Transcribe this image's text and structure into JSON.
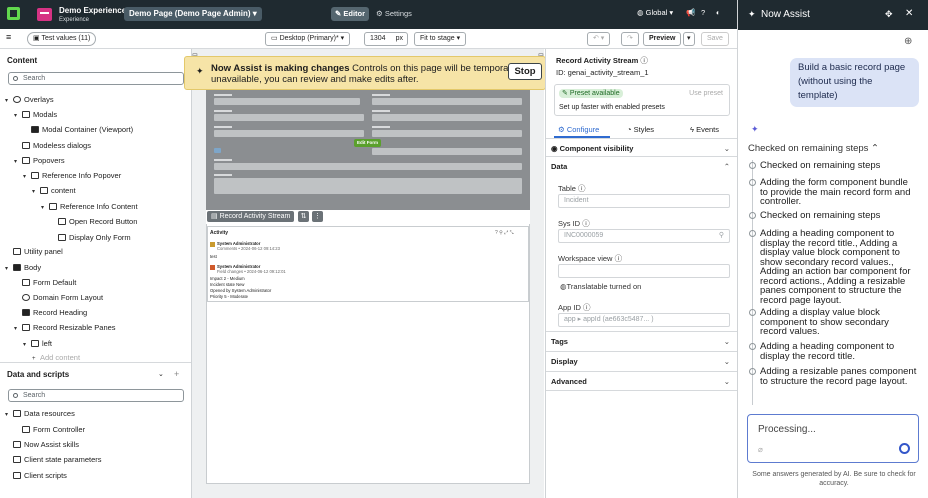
{
  "topbar": {
    "exp_title": "Demo Experience",
    "exp_sub": "Experience",
    "page_select": "Demo Page (Demo Page Admin)",
    "editor": "Editor",
    "settings": "Settings",
    "scope": "Global"
  },
  "toolbar": {
    "test_values": "Test values (11)",
    "device": "Desktop (Primary)*",
    "width": "1304",
    "width_unit": "px",
    "fit": "Fit to stage",
    "preview": "Preview",
    "save": "Save"
  },
  "left": {
    "content_title": "Content",
    "search_placeholder": "Search",
    "tree": [
      {
        "label": "Overlays"
      },
      {
        "label": "Modals"
      },
      {
        "label": "Modal Container (Viewport)"
      },
      {
        "label": "Modeless dialogs"
      },
      {
        "label": "Popovers"
      },
      {
        "label": "Reference Info Popover"
      },
      {
        "label": "content"
      },
      {
        "label": "Reference Info Content"
      },
      {
        "label": "Open Record Button"
      },
      {
        "label": "Display Only Form"
      },
      {
        "label": "Utility panel"
      },
      {
        "label": "Body"
      },
      {
        "label": "Form Default"
      },
      {
        "label": "Domain Form Layout"
      },
      {
        "label": "Record Heading"
      },
      {
        "label": "Record Resizable Panes"
      },
      {
        "label": "left"
      },
      {
        "label": "Add content"
      }
    ],
    "data_title": "Data and scripts",
    "data_search": "Search",
    "data_tree": [
      {
        "label": "Data resources"
      },
      {
        "label": "Form Controller"
      },
      {
        "label": "Now Assist skills"
      },
      {
        "label": "Client state parameters"
      },
      {
        "label": "Client scripts"
      }
    ]
  },
  "banner": {
    "bold": "Now Assist is making changes",
    "text": " Controls on this page will be temporarily unavailable, you can review and make edits after.",
    "stop": "Stop"
  },
  "stage": {
    "ras_tag": "Record Activity Stream",
    "edit_form": "Edit Form",
    "activity_title": "Activity",
    "act_lines": [
      "System Administrator",
      "Comments • 2024-06-12 09:14:23",
      "test",
      "System Administrator",
      "Field changes • 2024-06-12 09:12:01",
      "Impact          2 - Medium",
      "Incident state  New",
      "Opened by       System Administrator",
      "Priority        5 - Moderate"
    ]
  },
  "config": {
    "title": "Record Activity Stream",
    "id": "ID: genai_activity_stream_1",
    "preset_badge": "Preset available",
    "use_preset": "Use preset",
    "preset_desc": "Set up faster with enabled presets",
    "tabs": [
      "Configure",
      "Styles",
      "Events"
    ],
    "visibility": "Component visibility",
    "data_section": "Data",
    "table_label": "Table",
    "table_placeholder": "Incident",
    "sysid_label": "Sys ID",
    "sysid_placeholder": "INC0000059",
    "workspace_label": "Workspace view",
    "translatable": "Translatable turned on",
    "appid_label": "App ID",
    "appid_placeholder": "app ▸ appId (ae663c5487... )",
    "tags": "Tags",
    "display": "Display",
    "advanced": "Advanced"
  },
  "assist": {
    "title": "Now Assist",
    "user_msg": "Build a basic record page (without using the template)",
    "summary": "Checked on remaining steps",
    "steps": [
      "Checked on remaining steps",
      "Adding the form component bundle to provide the main record form and controller.",
      "Checked on remaining steps",
      "Adding a heading component to display the record title., Adding a display value block component to show secondary record values., Adding an action bar component for record actions., Adding a resizable panes component to structure the record page layout.",
      "Adding a display value block component to show secondary record values.",
      "Adding a heading component to display the record title.",
      "Adding a resizable panes component to structure the record page layout."
    ],
    "input_placeholder": "Processing...",
    "footer": "Some answers generated by AI. Be sure to check for accuracy."
  }
}
